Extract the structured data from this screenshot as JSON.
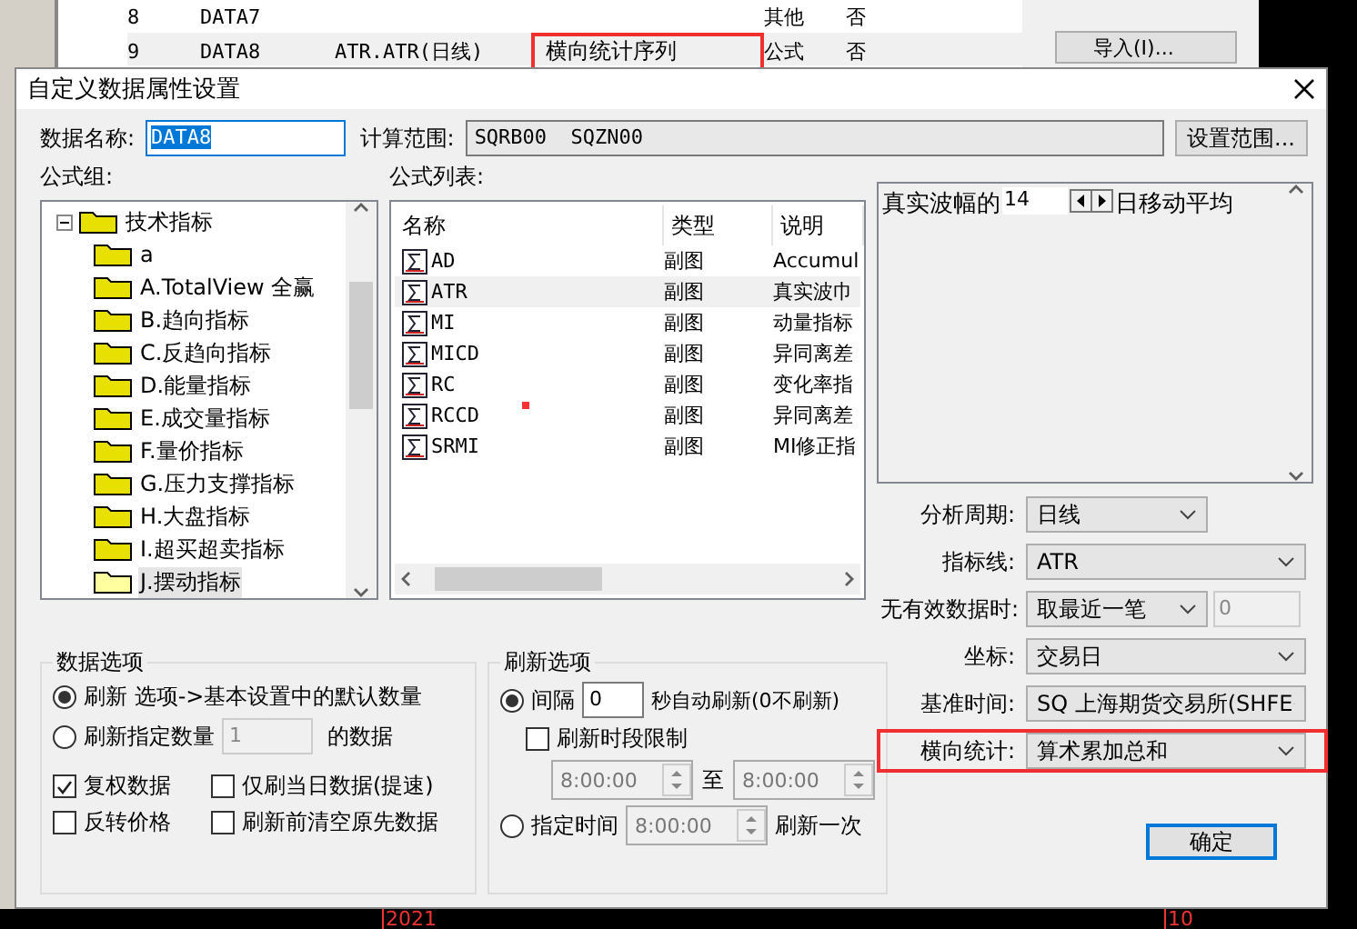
{
  "background": {
    "table_rows": [
      {
        "number": "8",
        "name": "DATA7",
        "category": "其他",
        "flag": "否"
      },
      {
        "number": "9",
        "name": "DATA8",
        "formula": "ATR.ATR(日线)",
        "series": "横向统计序列",
        "category": "公式",
        "flag": "否",
        "highlighted": true
      }
    ],
    "import_button": "导入(I)...",
    "timeline": [
      "2021",
      "10"
    ]
  },
  "dialog": {
    "title": "自定义数据属性设置",
    "name": {
      "label": "数据名称:",
      "value": "DATA8"
    },
    "range": {
      "label": "计算范围:",
      "value": "SQRB00  SQZN00",
      "button": "设置范围..."
    },
    "formula_group": {
      "label": "公式组:",
      "tree": [
        {
          "label": "技术指标",
          "expanded": true,
          "children": [
            {
              "label": "a",
              "selected": false
            },
            {
              "label": "A.TotalView 全赢",
              "selected": false
            },
            {
              "label": "B.趋向指标",
              "selected": false
            },
            {
              "label": "C.反趋向指标",
              "selected": false
            },
            {
              "label": "D.能量指标",
              "selected": false
            },
            {
              "label": "E.成交量指标",
              "selected": false
            },
            {
              "label": "F.量价指标",
              "selected": false
            },
            {
              "label": "G.压力支撑指标",
              "selected": false
            },
            {
              "label": "H.大盘指标",
              "selected": false
            },
            {
              "label": "I.超买超卖指标",
              "selected": false
            },
            {
              "label": "J.摆动指标",
              "selected": true
            }
          ]
        }
      ]
    },
    "formula_list": {
      "label": "公式列表:",
      "columns": [
        "名称",
        "类型",
        "说明"
      ],
      "rows": [
        {
          "name": "AD",
          "type": "副图",
          "desc": "Accumul",
          "selected": false
        },
        {
          "name": "ATR",
          "type": "副图",
          "desc": "真实波巾",
          "selected": true
        },
        {
          "name": "MI",
          "type": "副图",
          "desc": "动量指标",
          "selected": false
        },
        {
          "name": "MICD",
          "type": "副图",
          "desc": "异同离差",
          "selected": false
        },
        {
          "name": "RC",
          "type": "副图",
          "desc": "变化率指",
          "selected": false
        },
        {
          "name": "RCCD",
          "type": "副图",
          "desc": "异同离差",
          "selected": false
        },
        {
          "name": "SRMI",
          "type": "副图",
          "desc": "MI修正指",
          "selected": false
        }
      ]
    },
    "description": {
      "before": "真实波幅的",
      "value": "14",
      "after": "日移动平均"
    },
    "fields": [
      {
        "label": "分析周期:",
        "value": "日线",
        "kind": "short",
        "highlighted": false
      },
      {
        "label": "指标线:",
        "value": "ATR",
        "kind": "wide",
        "highlighted": false
      },
      {
        "label": "无有效数据时:",
        "value": "取最近一笔",
        "extra": "0",
        "kind": "short",
        "highlighted": false
      },
      {
        "label": "坐标:",
        "value": "交易日",
        "kind": "wide",
        "highlighted": false
      },
      {
        "label": "基准时间:",
        "value": "SQ 上海期货交易所(SHFE",
        "kind": "wide",
        "highlighted": false
      },
      {
        "label": "横向统计:",
        "value": "算术累加总和",
        "kind": "wide",
        "highlighted": true
      }
    ],
    "data_options": {
      "title": "数据选项",
      "radios": [
        {
          "label": "刷新 选项->基本设置中的默认数量",
          "selected": true
        },
        {
          "label": "刷新指定数量",
          "selected": false,
          "input": "1",
          "suffix": "的数据"
        }
      ],
      "checks": [
        {
          "label": "复权数据",
          "checked": true
        },
        {
          "label": "仅刷当日数据(提速)",
          "checked": false
        },
        {
          "label": "反转价格",
          "checked": false
        },
        {
          "label": "刷新前清空原先数据",
          "checked": false
        }
      ]
    },
    "refresh_options": {
      "title": "刷新选项",
      "interval": {
        "label": "间隔",
        "value": "0",
        "suffix": "秒自动刷新(0不刷新)",
        "selected": true
      },
      "period": {
        "label": "刷新时段限制",
        "checked": false,
        "from": "8:00:00",
        "separator": "至",
        "to": "8:00:00"
      },
      "at_time": {
        "label": "指定时间",
        "value": "8:00:00",
        "suffix": "刷新一次",
        "selected": false
      }
    },
    "ok_button": "确定"
  }
}
